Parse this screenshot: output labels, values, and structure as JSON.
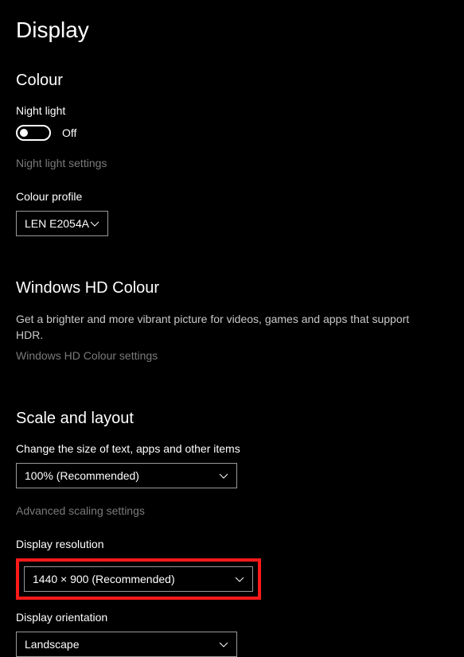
{
  "page": {
    "title": "Display"
  },
  "colour": {
    "heading": "Colour",
    "nightLightLabel": "Night light",
    "toggleState": "Off",
    "settingsLink": "Night light settings",
    "profileLabel": "Colour profile",
    "profileValue": "LEN E2054A"
  },
  "hd": {
    "heading": "Windows HD Colour",
    "description": "Get a brighter and more vibrant picture for videos, games and apps that support HDR.",
    "settingsLink": "Windows HD Colour settings"
  },
  "scale": {
    "heading": "Scale and layout",
    "sizeLabel": "Change the size of text, apps and other items",
    "sizeValue": "100% (Recommended)",
    "advancedLink": "Advanced scaling settings",
    "resolutionLabel": "Display resolution",
    "resolutionValue": "1440 × 900 (Recommended)",
    "orientationLabel": "Display orientation",
    "orientationValue": "Landscape"
  }
}
